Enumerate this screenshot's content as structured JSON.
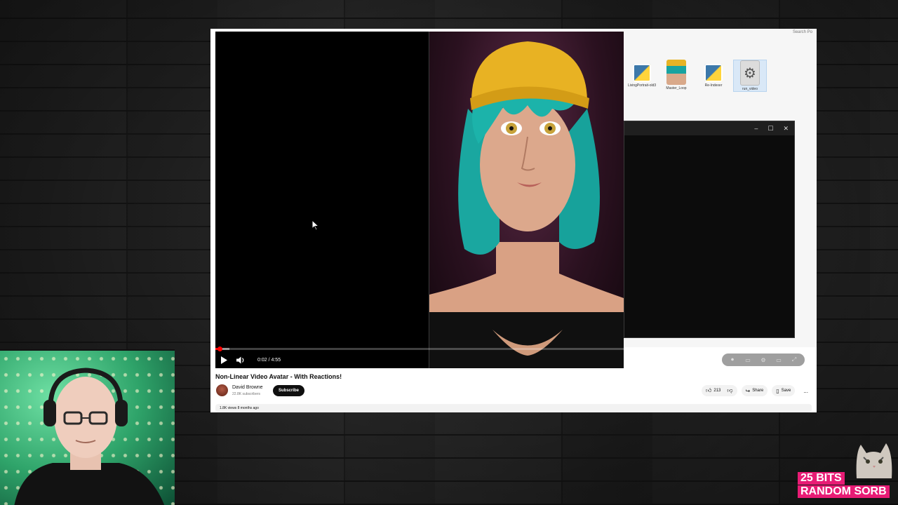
{
  "window": {
    "search_hint": "Search Po"
  },
  "desktop_files": [
    {
      "label": "LivingPortrait-old3",
      "icon": "python-file-icon"
    },
    {
      "label": "Master_Loop",
      "icon": "portrait-thumbnail-icon"
    },
    {
      "label": "Re-Indexer",
      "icon": "python-file-icon"
    },
    {
      "label": "run_video",
      "icon": "gear-file-icon"
    }
  ],
  "terminal": {
    "controls": [
      "–",
      "☐",
      "✕"
    ]
  },
  "player": {
    "time": "0:02 / 4:55",
    "progress_fraction": 0.007,
    "buffered_fraction": 0.024
  },
  "video": {
    "title": "Non-Linear Video Avatar - With Reactions!",
    "channel": "David Browne",
    "subscribers": "22.8K subscribers",
    "subscribe_label": "Subscribe",
    "likes": "213",
    "share_label": "Share",
    "save_label": "Save",
    "more_label": "...",
    "meta": "1.8K views  8 months ago"
  },
  "overlay": {
    "badge_line1": "25 BITS",
    "badge_line2": "RANDOM SORB"
  },
  "colors": {
    "accent": "#ff0000",
    "badge": "#e81c75"
  }
}
